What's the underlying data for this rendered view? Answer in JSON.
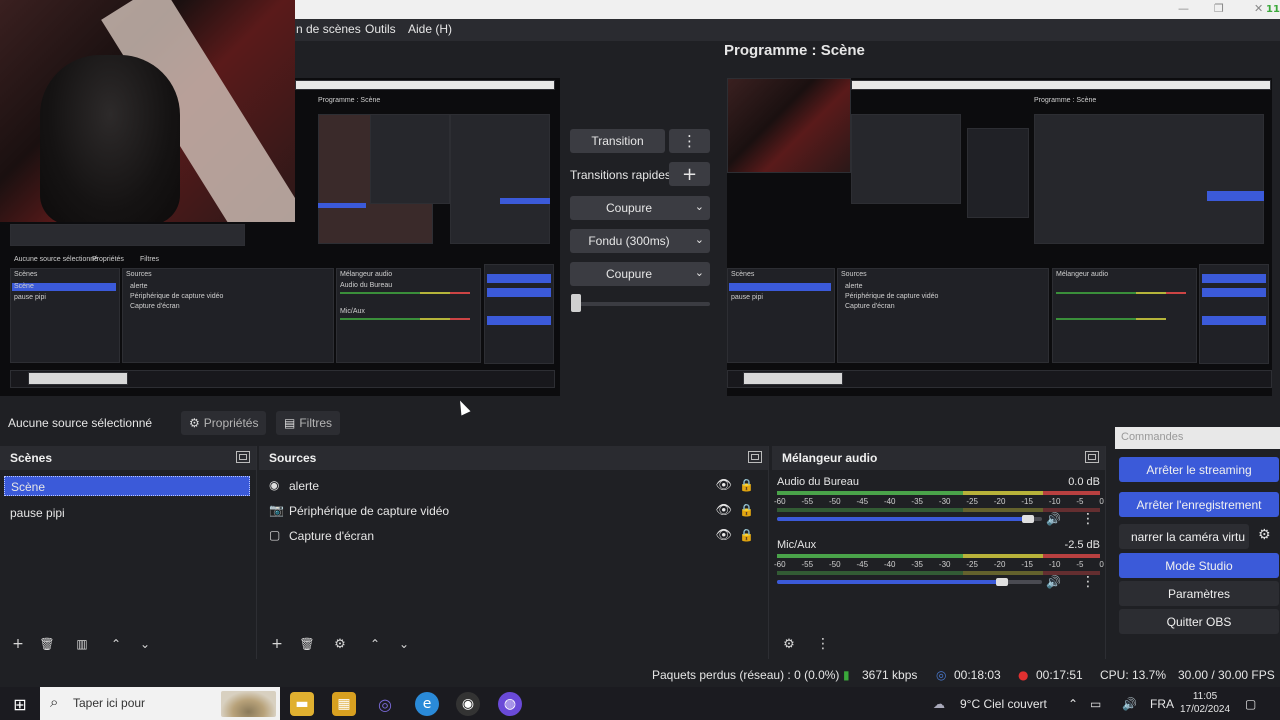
{
  "menu": {
    "items": [
      "n de scènes",
      "Outils",
      "Aide (H)"
    ]
  },
  "window": {
    "minimize": "—",
    "maximize": "❐",
    "close": "✕",
    "corner_badge": "11"
  },
  "program": {
    "title": "Programme : Scène"
  },
  "preview_contents": {
    "mini_title": "Programme : Scène",
    "no_source": "Aucune source sélectionné",
    "properties": "Propriétés",
    "filters": "Filtres",
    "scenes": "Scènes",
    "sources": "Sources",
    "mixer": "Mélangeur audio",
    "scene_items": [
      "Scène",
      "pause pipi"
    ],
    "source_items": [
      "alerte",
      "Périphérique de capture vidéo",
      "Capture d'écran"
    ],
    "controls": [
      "Arrêter le streaming",
      "Arrêter l'enregistrement",
      "Démarrer la caméra virtuelle",
      "Mode Studio",
      "Paramètres",
      "Quitter OBS"
    ],
    "taskbar_search": "Taper ici pour",
    "audio_desktop": "Audio du Bureau",
    "mic": "Mic/Aux",
    "transition": "Transition",
    "quick": "Transitions rapides",
    "cut": "Coupure",
    "fade": "Fondu (300ms)"
  },
  "transitions": {
    "transition_label": "Transition",
    "more_icon": "⋮",
    "quick_label": "Transitions rapides",
    "add_icon": "+",
    "dropdowns": [
      "Coupure",
      "Fondu (300ms)",
      "Coupure"
    ]
  },
  "context": {
    "no_source": "Aucune source sélectionné",
    "properties": "Propriétés",
    "filters": "Filtres"
  },
  "scenes": {
    "title": "Scènes",
    "items": [
      "Scène",
      "pause pipi"
    ],
    "selected_index": 0
  },
  "sources": {
    "title": "Sources",
    "items": [
      {
        "name": "alerte",
        "icon": "alert-icon"
      },
      {
        "name": "Périphérique de capture vidéo",
        "icon": "camera-icon"
      },
      {
        "name": "Capture d'écran",
        "icon": "monitor-icon"
      }
    ]
  },
  "mixer": {
    "title": "Mélangeur audio",
    "channels": [
      {
        "name": "Audio du Bureau",
        "db": "0.0 dB",
        "volume": 0.97
      },
      {
        "name": "Mic/Aux",
        "db": "-2.5 dB",
        "volume": 0.87
      }
    ],
    "scale": [
      "-60",
      "-55",
      "-50",
      "-45",
      "-40",
      "-35",
      "-30",
      "-25",
      "-20",
      "-15",
      "-10",
      "-5",
      "0"
    ]
  },
  "controls": {
    "title": "Commandes",
    "buttons": [
      {
        "label": "Arrêter le streaming",
        "style": "blue"
      },
      {
        "label": "Arrêter l'enregistrement",
        "style": "blue"
      },
      {
        "label": "narrer la caméra virtu",
        "style": "gray"
      },
      {
        "label": "Mode Studio",
        "style": "blue"
      },
      {
        "label": "Paramètres",
        "style": "gray"
      },
      {
        "label": "Quitter OBS",
        "style": "gray"
      }
    ]
  },
  "status": {
    "dropped": "Paquets perdus (réseau) : 0 (0.0%)",
    "bitrate": "3671 kbps",
    "stream_time": "00:18:03",
    "rec_time": "00:17:51",
    "cpu": "CPU: 13.7%",
    "fps": "30.00 / 30.00 FPS"
  },
  "taskbar": {
    "search_placeholder": "Taper ici pour",
    "weather": "9°C  Ciel couvert",
    "lang": "FRA",
    "time": "11:05",
    "date": "17/02/2024"
  },
  "colors": {
    "accent": "#3b5ad9",
    "background": "#1f2024",
    "panel": "#2a2b30"
  }
}
